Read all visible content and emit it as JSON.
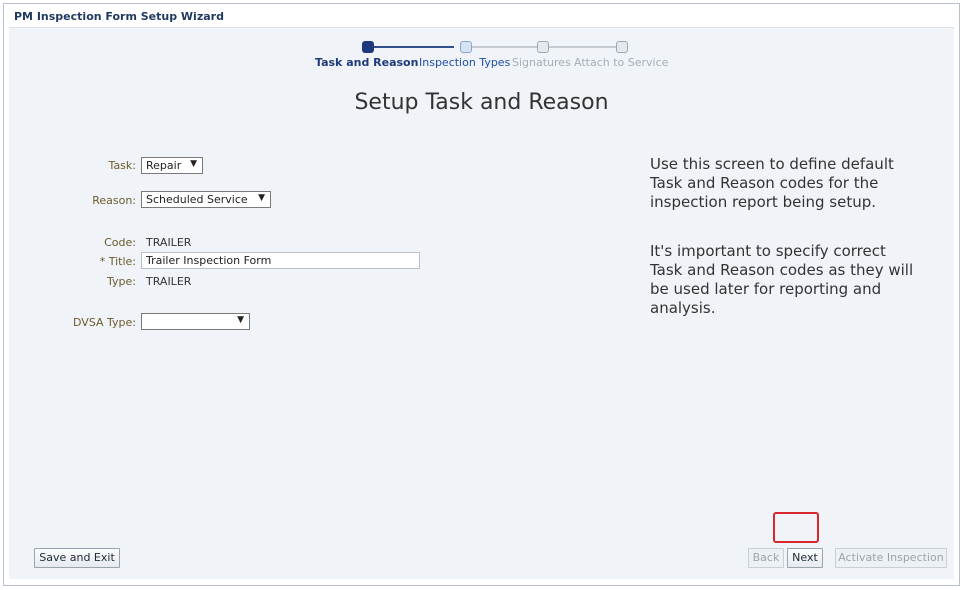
{
  "window": {
    "title": "PM Inspection Form Setup Wizard"
  },
  "train": {
    "steps": [
      {
        "label": "Task and Reason",
        "state": "current"
      },
      {
        "label": "Inspection Types",
        "state": "next"
      },
      {
        "label": "Signatures",
        "state": "disabled"
      },
      {
        "label": "Attach to Service",
        "state": "disabled"
      }
    ]
  },
  "page": {
    "title": "Setup Task and Reason"
  },
  "form": {
    "task": {
      "label": "Task:",
      "value": "Repair"
    },
    "reason": {
      "label": "Reason:",
      "value": "Scheduled Service"
    },
    "code": {
      "label": "Code:",
      "value": "TRAILER"
    },
    "title": {
      "label": "* Title:",
      "value": "Trailer Inspection Form"
    },
    "type": {
      "label": "Type:",
      "value": "TRAILER"
    },
    "dvsa_type": {
      "label": "DVSA Type:",
      "value": ""
    }
  },
  "help": {
    "paragraph1": "Use this screen to define default Task and Reason codes for the inspection report being setup.",
    "paragraph2": "It's important to specify correct Task and Reason codes as they will be used later for reporting and analysis."
  },
  "footer": {
    "save_exit": "Save and Exit",
    "back": "Back",
    "next": "Next",
    "activate": "Activate Inspection"
  },
  "colors": {
    "accent": "#1f3a7a",
    "highlight": "#d9262c",
    "panel_bg": "#f0f4f8"
  },
  "icons": {
    "dropdown": "triangle-down"
  }
}
